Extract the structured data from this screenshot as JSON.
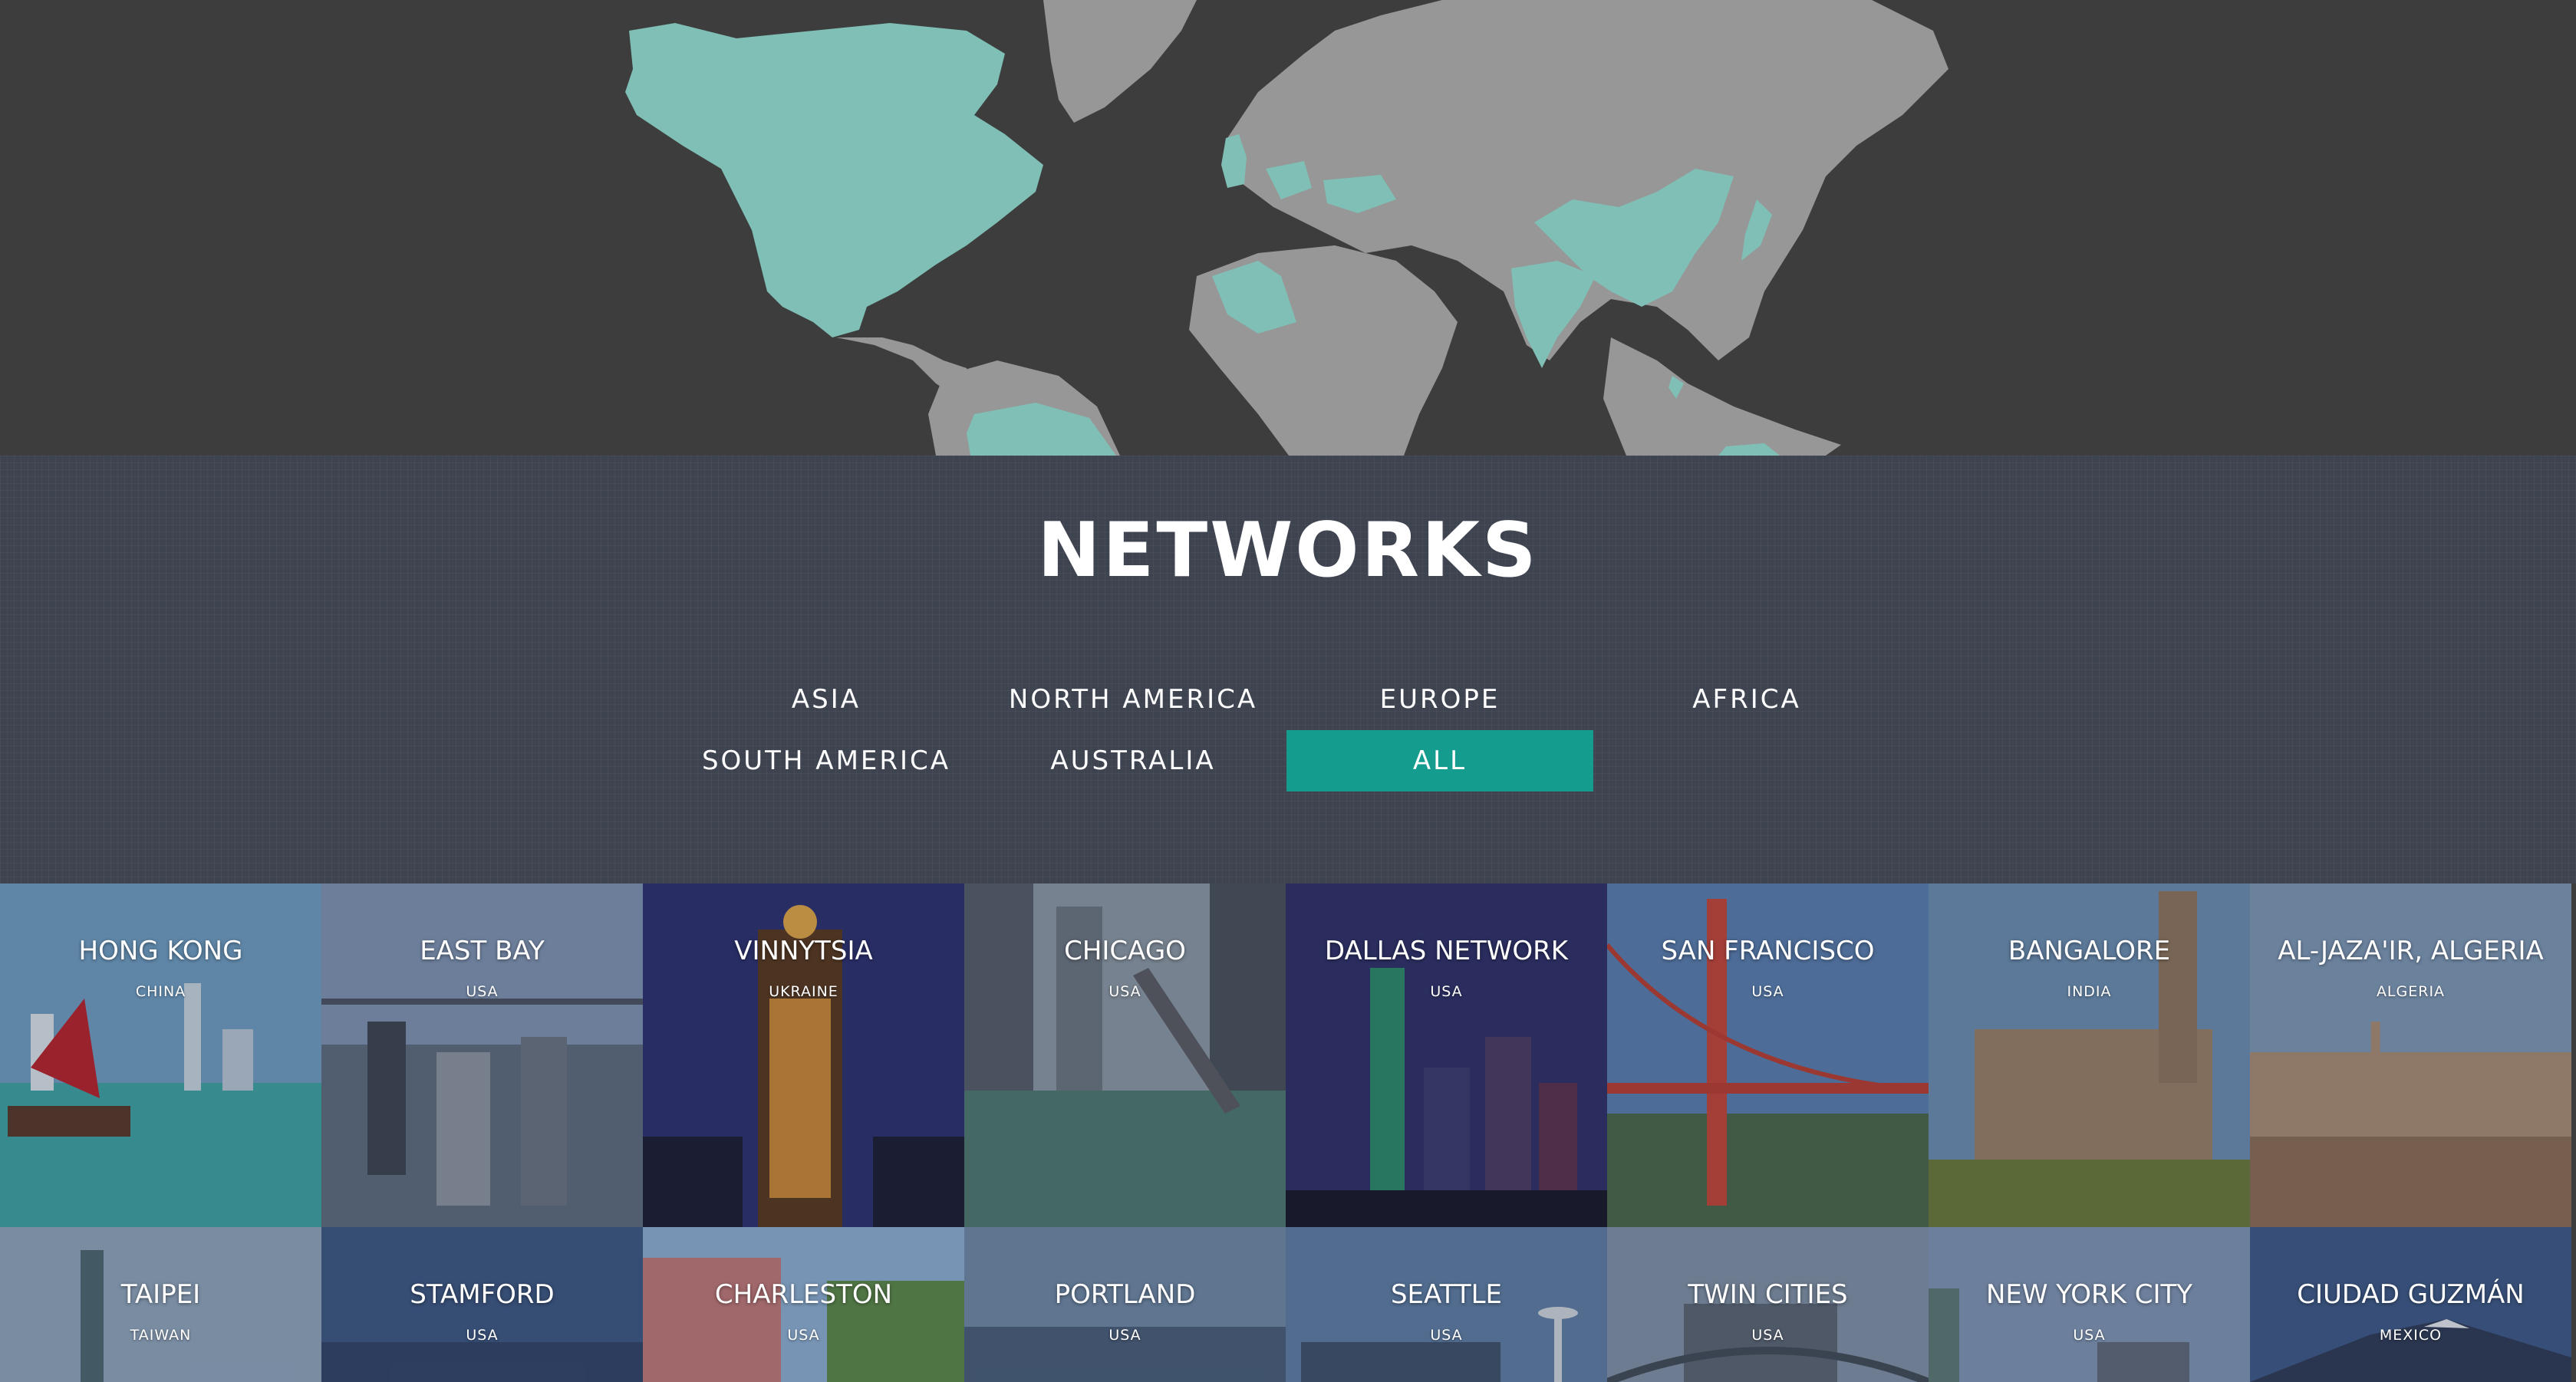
{
  "colors": {
    "map_background": "#3d3d3e",
    "land": "#979797",
    "network_region": "#7fbfb5",
    "networks_background": "#3e4350",
    "active_filter": "#149c8e"
  },
  "networks": {
    "title": "NETWORKS",
    "filters": [
      {
        "label": "ASIA",
        "active": false
      },
      {
        "label": "NORTH AMERICA",
        "active": false
      },
      {
        "label": "EUROPE",
        "active": false
      },
      {
        "label": "AFRICA",
        "active": false
      },
      {
        "label": "SOUTH AMERICA",
        "active": false
      },
      {
        "label": "AUSTRALIA",
        "active": false
      },
      {
        "label": "ALL",
        "active": true
      }
    ]
  },
  "tiles": [
    {
      "city": "HONG KONG",
      "country": "CHINA"
    },
    {
      "city": "EAST BAY",
      "country": "USA"
    },
    {
      "city": "VINNYTSIA",
      "country": "UKRAINE"
    },
    {
      "city": "CHICAGO",
      "country": "USA"
    },
    {
      "city": "DALLAS NETWORK",
      "country": "USA"
    },
    {
      "city": "SAN FRANCISCO",
      "country": "USA"
    },
    {
      "city": "BANGALORE",
      "country": "INDIA"
    },
    {
      "city": "AL-JAZA'IR, ALGERIA",
      "country": "ALGERIA"
    },
    {
      "city": "TAIPEI",
      "country": "TAIWAN"
    },
    {
      "city": "STAMFORD",
      "country": "USA"
    },
    {
      "city": "CHARLESTON",
      "country": "USA"
    },
    {
      "city": "PORTLAND",
      "country": "USA"
    },
    {
      "city": "SEATTLE",
      "country": "USA"
    },
    {
      "city": "TWIN CITIES",
      "country": "USA"
    },
    {
      "city": "NEW YORK CITY",
      "country": "USA"
    },
    {
      "city": "CIUDAD GUZMÁN",
      "country": "MEXICO"
    }
  ]
}
